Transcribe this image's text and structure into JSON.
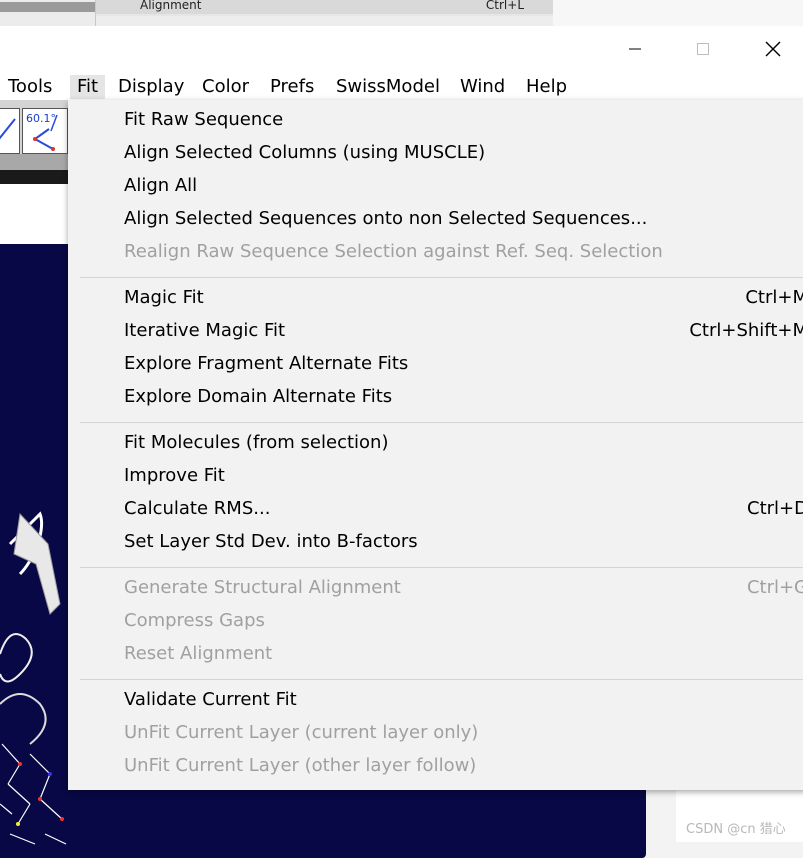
{
  "background_window": {
    "row_label": "Alignment",
    "row_accel": "Ctrl+L"
  },
  "menubar": {
    "items": [
      "Tools",
      "Fit",
      "Display",
      "Color",
      "Prefs",
      "SwissModel",
      "Wind",
      "Help"
    ],
    "active": "Fit"
  },
  "toolbar": {
    "angle_label": "60.1°"
  },
  "fit_menu": {
    "groups": [
      [
        {
          "label": "Fit Raw Sequence",
          "shortcut": "",
          "enabled": true
        },
        {
          "label": "Align Selected Columns (using MUSCLE)",
          "shortcut": "",
          "enabled": true
        },
        {
          "label": "Align All",
          "shortcut": "",
          "enabled": true
        },
        {
          "label": "Align Selected Sequences onto non Selected Sequences...",
          "shortcut": "",
          "enabled": true
        },
        {
          "label": "Realign Raw Sequence Selection against Ref. Seq. Selection",
          "shortcut": "",
          "enabled": false
        }
      ],
      [
        {
          "label": "Magic Fit",
          "shortcut": "Ctrl+M",
          "enabled": true
        },
        {
          "label": "Iterative Magic Fit",
          "shortcut": "Ctrl+Shift+M",
          "enabled": true
        },
        {
          "label": "Explore Fragment Alternate Fits",
          "shortcut": "",
          "enabled": true
        },
        {
          "label": "Explore Domain Alternate Fits",
          "shortcut": "",
          "enabled": true
        }
      ],
      [
        {
          "label": "Fit Molecules (from selection)",
          "shortcut": "",
          "enabled": true
        },
        {
          "label": "Improve Fit",
          "shortcut": "",
          "enabled": true
        },
        {
          "label": "Calculate RMS...",
          "shortcut": "Ctrl+D",
          "enabled": true
        },
        {
          "label": "Set Layer Std Dev. into B-factors",
          "shortcut": "",
          "enabled": true
        }
      ],
      [
        {
          "label": "Generate Structural Alignment",
          "shortcut": "Ctrl+G",
          "enabled": false
        },
        {
          "label": "Compress Gaps",
          "shortcut": "",
          "enabled": false
        },
        {
          "label": "Reset Alignment",
          "shortcut": "",
          "enabled": false
        }
      ],
      [
        {
          "label": "Validate Current Fit",
          "shortcut": "",
          "enabled": true
        },
        {
          "label": "UnFit Current Layer (current layer only)",
          "shortcut": "",
          "enabled": false
        },
        {
          "label": "UnFit Current Layer (other layer follow)",
          "shortcut": "",
          "enabled": false
        }
      ]
    ]
  },
  "watermark": "CSDN @cn 猎心",
  "colors": {
    "viewer_background": "#080846",
    "disabled_text": "#a0a0a0",
    "menu_background": "#f2f2f2"
  }
}
